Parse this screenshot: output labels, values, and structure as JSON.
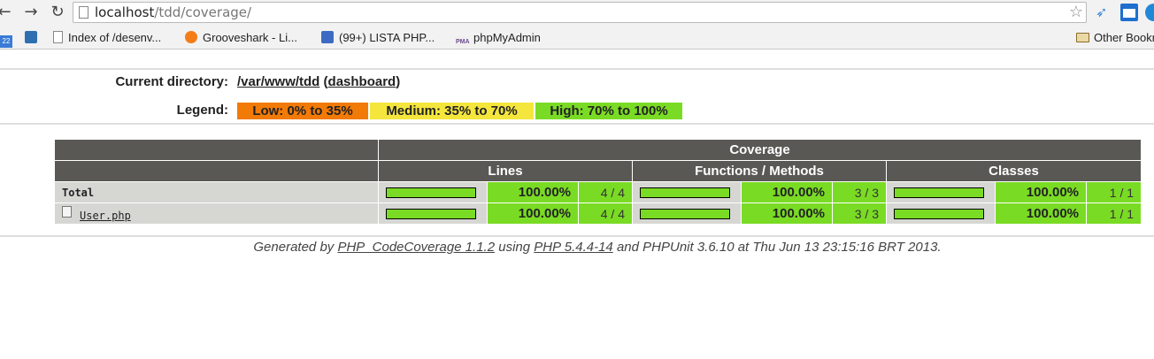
{
  "browser": {
    "url_host": "localhost",
    "url_path": "/tdd/coverage/",
    "bookmarks": [
      {
        "label": ""
      },
      {
        "label": ""
      },
      {
        "label": "Index of /desenv..."
      },
      {
        "label": "Grooveshark - Li..."
      },
      {
        "label": "(99+) LISTA PHP..."
      },
      {
        "label": "phpMyAdmin"
      }
    ],
    "calendar_day": "22",
    "pma_icon_text": "PMA",
    "other_bookmarks": "Other Bookmarks"
  },
  "header": {
    "current_directory_label": "Current directory:",
    "directory_path": "/var/www/tdd",
    "open_paren": " (",
    "dashboard_link": "dashboard",
    "close_paren": ")",
    "legend_label": "Legend:",
    "legend": [
      {
        "label": "Low: 0% to 35%",
        "color": "#f27a06"
      },
      {
        "label": "Medium: 35% to 70%",
        "color": "#f5e63d"
      },
      {
        "label": "High: 70% to 100%",
        "color": "#7adb24"
      }
    ]
  },
  "table": {
    "header_coverage": "Coverage",
    "columns": [
      "Lines",
      "Functions / Methods",
      "Classes"
    ],
    "rows": [
      {
        "name": "Total",
        "lines": {
          "fraction": 1.0,
          "percent": "100.00%",
          "count": "4 / 4"
        },
        "functions": {
          "fraction": 1.0,
          "percent": "100.00%",
          "count": "3 / 3"
        },
        "classes": {
          "fraction": 1.0,
          "percent": "100.00%",
          "count": "1 / 1"
        }
      },
      {
        "name": "User.php",
        "lines": {
          "fraction": 1.0,
          "percent": "100.00%",
          "count": "4 / 4"
        },
        "functions": {
          "fraction": 1.0,
          "percent": "100.00%",
          "count": "3 / 3"
        },
        "classes": {
          "fraction": 1.0,
          "percent": "100.00%",
          "count": "1 / 1"
        }
      }
    ]
  },
  "footer": {
    "prefix": "Generated by ",
    "codecoverage_link": "PHP_CodeCoverage 1.1.2",
    "using": " using ",
    "php_link": "PHP 5.4.4-14",
    "suffix": " and PHPUnit 3.6.10 at Thu Jun 13 23:15:16 BRT 2013."
  },
  "icons": [
    "back-icon",
    "forward-icon",
    "reload-icon",
    "page-icon",
    "star-icon",
    "folder-icon",
    "file-icon"
  ]
}
